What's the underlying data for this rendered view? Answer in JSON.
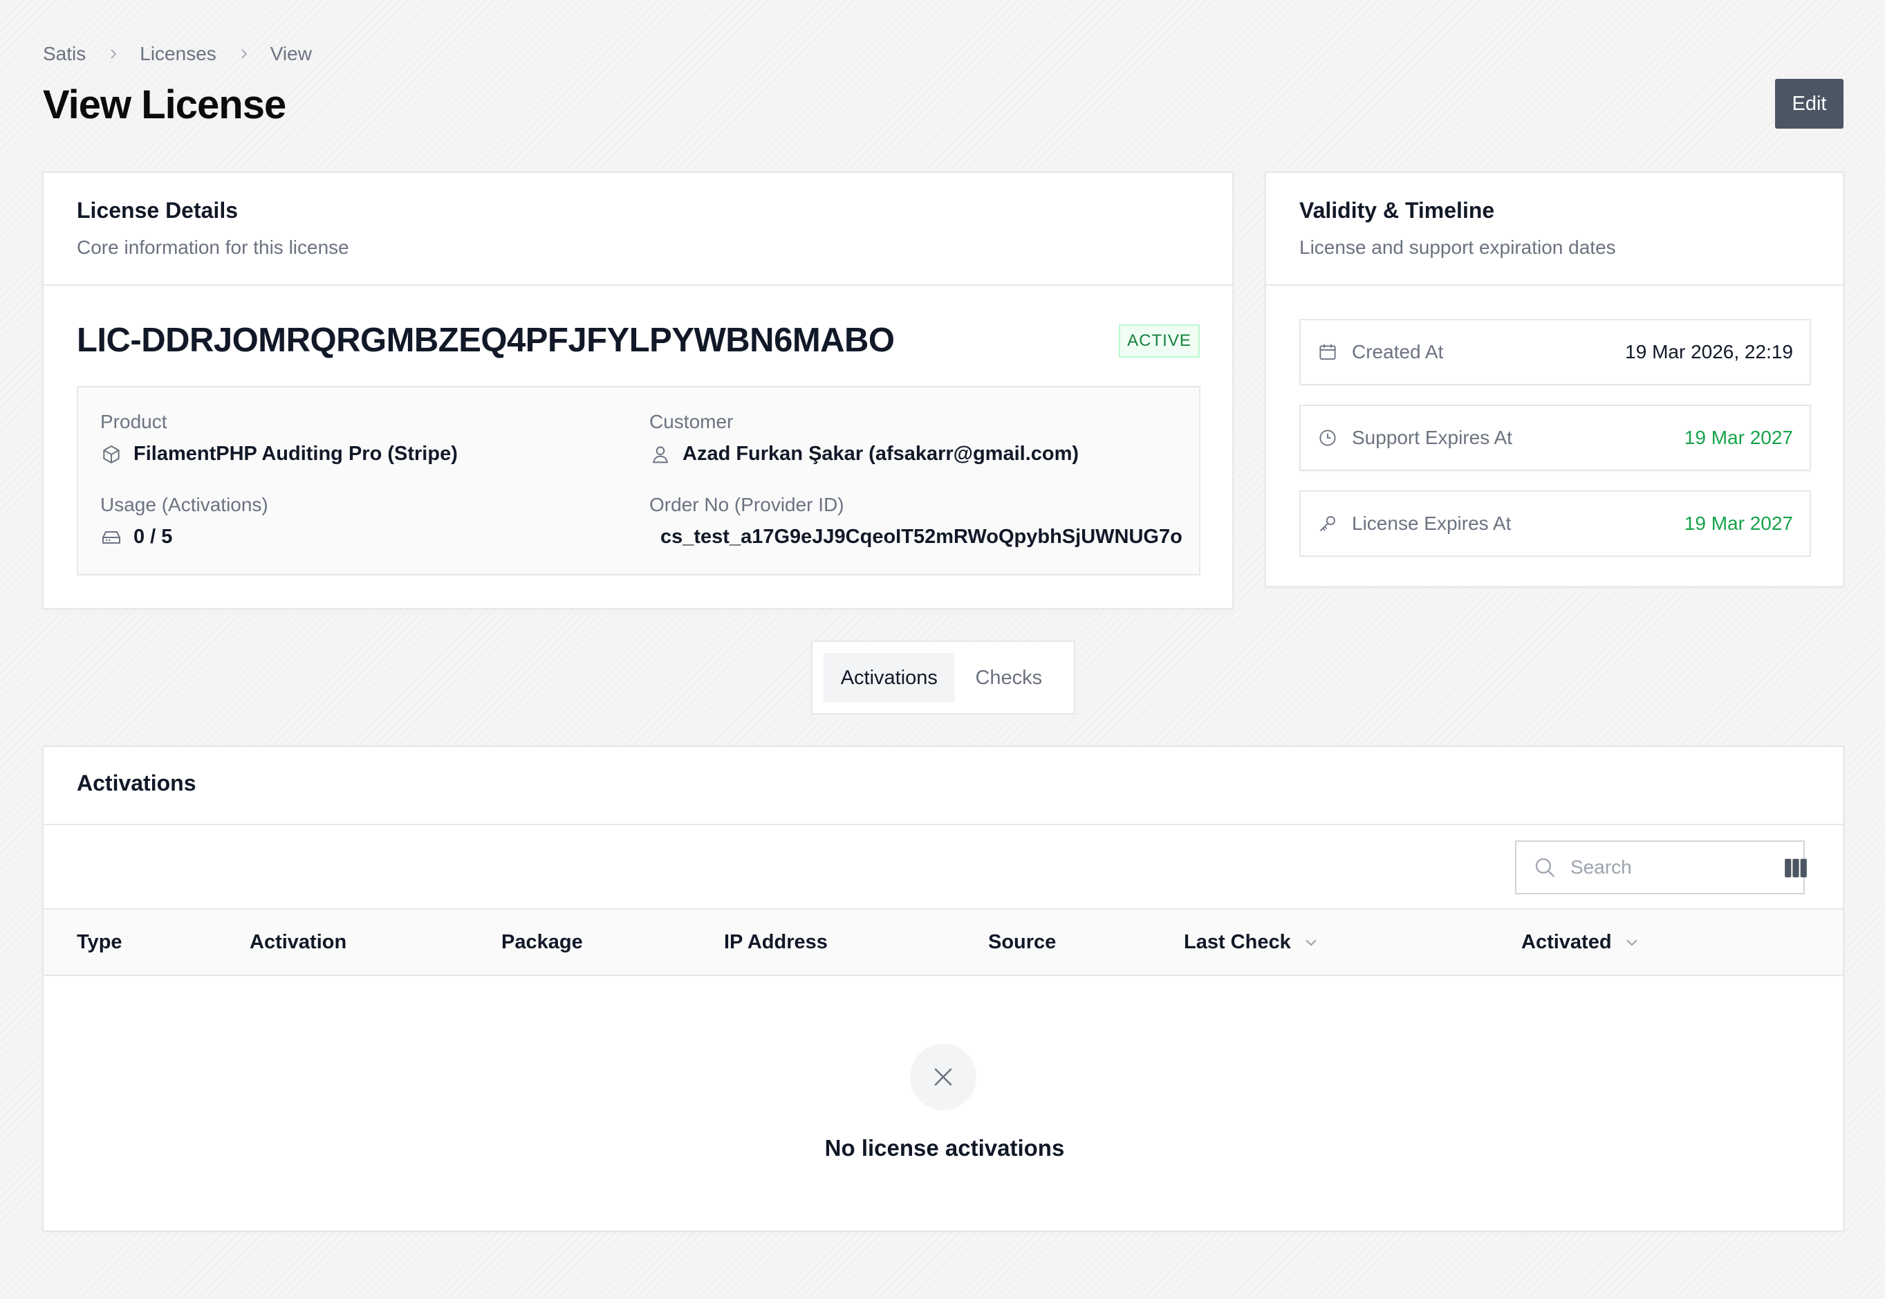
{
  "breadcrumb": {
    "items": [
      "Satis",
      "Licenses",
      "View"
    ]
  },
  "page": {
    "title": "View License",
    "edit_label": "Edit"
  },
  "license_details": {
    "title": "License Details",
    "subtitle": "Core information for this license",
    "key": "LIC-DDRJOMRQRGMBZEQ4PFJFYLPYWBN6MABO",
    "status": "ACTIVE",
    "product_label": "Product",
    "product_value": "FilamentPHP Auditing Pro (Stripe)",
    "customer_label": "Customer",
    "customer_value": "Azad Furkan Şakar (afsakarr@gmail.com)",
    "usage_label": "Usage (Activations)",
    "usage_value": "0 / 5",
    "order_label": "Order No (Provider ID)",
    "order_value": "cs_test_a17G9eJJ9CqeoIT52mRWoQpybhSjUWNUG7o"
  },
  "validity": {
    "title": "Validity & Timeline",
    "subtitle": "License and support expiration dates",
    "rows": [
      {
        "label": "Created At",
        "value": "19 Mar 2026, 22:19",
        "icon": "calendar-icon"
      },
      {
        "label": "Support Expires At",
        "value": "19 Mar 2027",
        "icon": "clock-icon"
      },
      {
        "label": "License Expires At",
        "value": "19 Mar 2027",
        "icon": "key-icon"
      }
    ]
  },
  "tabs": [
    "Activations",
    "Checks"
  ],
  "activations": {
    "title": "Activations",
    "search_placeholder": "Search",
    "columns": [
      "Type",
      "Activation",
      "Package",
      "IP Address",
      "Source",
      "Last Check",
      "Activated"
    ],
    "empty_message": "No license activations"
  },
  "colors": {
    "accent_button": "#4b5563",
    "success": "#16a34a"
  }
}
